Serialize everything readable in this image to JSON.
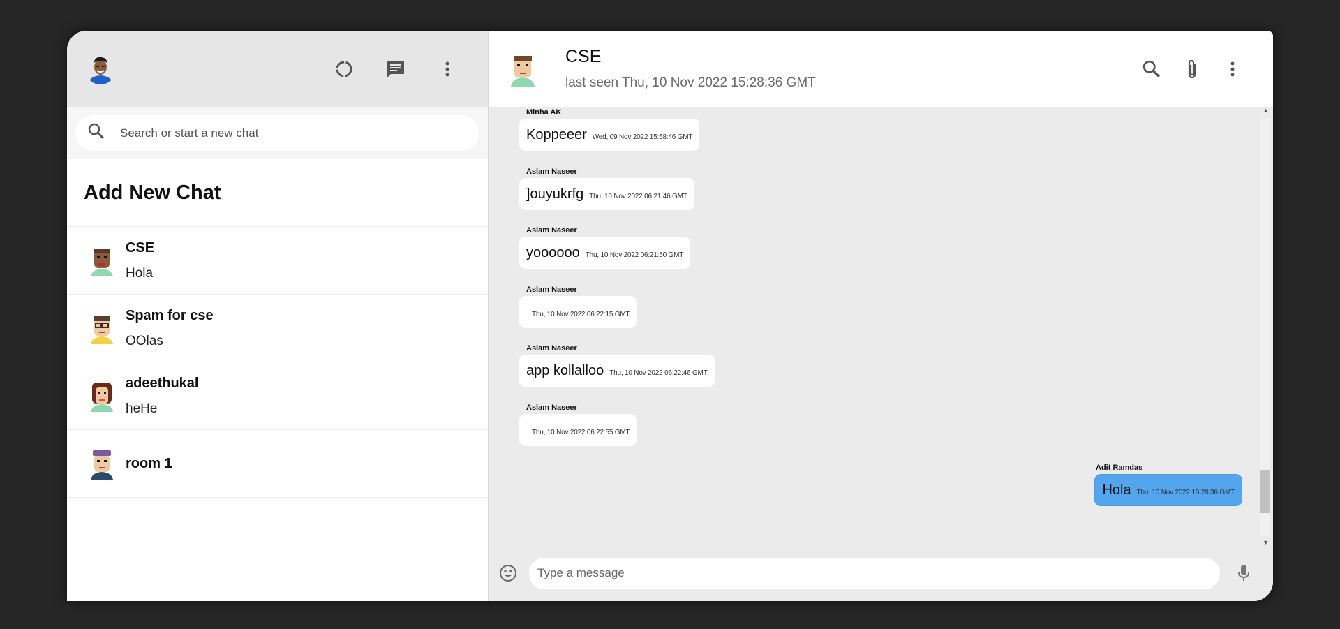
{
  "sidebar": {
    "search_placeholder": "Search or start a new chat",
    "add_new_chat": "Add New Chat",
    "chats": [
      {
        "name": "CSE",
        "last": "Hola"
      },
      {
        "name": "Spam for cse",
        "last": "OOlas"
      },
      {
        "name": "adeethukal",
        "last": "heHe"
      },
      {
        "name": "room 1",
        "last": ""
      }
    ]
  },
  "chat": {
    "name": "CSE",
    "last_seen": "last seen Thu, 10 Nov 2022 15:28:36 GMT",
    "messages": [
      {
        "sender": "Minha AK",
        "text": "Koppeeer",
        "time": "Wed, 09 Nov 2022 15:58:46 GMT"
      },
      {
        "sender": "Aslam Naseer",
        "text": "]ouyukrfg",
        "time": "Thu, 10 Nov 2022 06:21:46 GMT"
      },
      {
        "sender": "Aslam Naseer",
        "text": "yoooooo",
        "time": "Thu, 10 Nov 2022 06:21:50 GMT"
      },
      {
        "sender": "Aslam Naseer",
        "text": "",
        "time": "Thu, 10 Nov 2022 06:22:15 GMT"
      },
      {
        "sender": "Aslam Naseer",
        "text": "app kollalloo",
        "time": "Thu, 10 Nov 2022 06:22:46 GMT"
      },
      {
        "sender": "Aslam Naseer",
        "text": "",
        "time": "Thu, 10 Nov 2022 06:22:55 GMT"
      },
      {
        "sender": "Adit Ramdas",
        "text": "Hola",
        "time": "Thu, 10 Nov 2022 15:28:36 GMT"
      }
    ],
    "composer_placeholder": "Type a message"
  },
  "colors": {
    "background": "#262626",
    "header_gray": "#e6e6e6",
    "chat_bg": "#ebebeb",
    "own_bubble": "#53a6ee"
  },
  "icons": [
    "status-icon",
    "new-chat-icon",
    "menu-icon",
    "search-icon",
    "attach-icon",
    "emoji-icon",
    "mic-icon"
  ]
}
